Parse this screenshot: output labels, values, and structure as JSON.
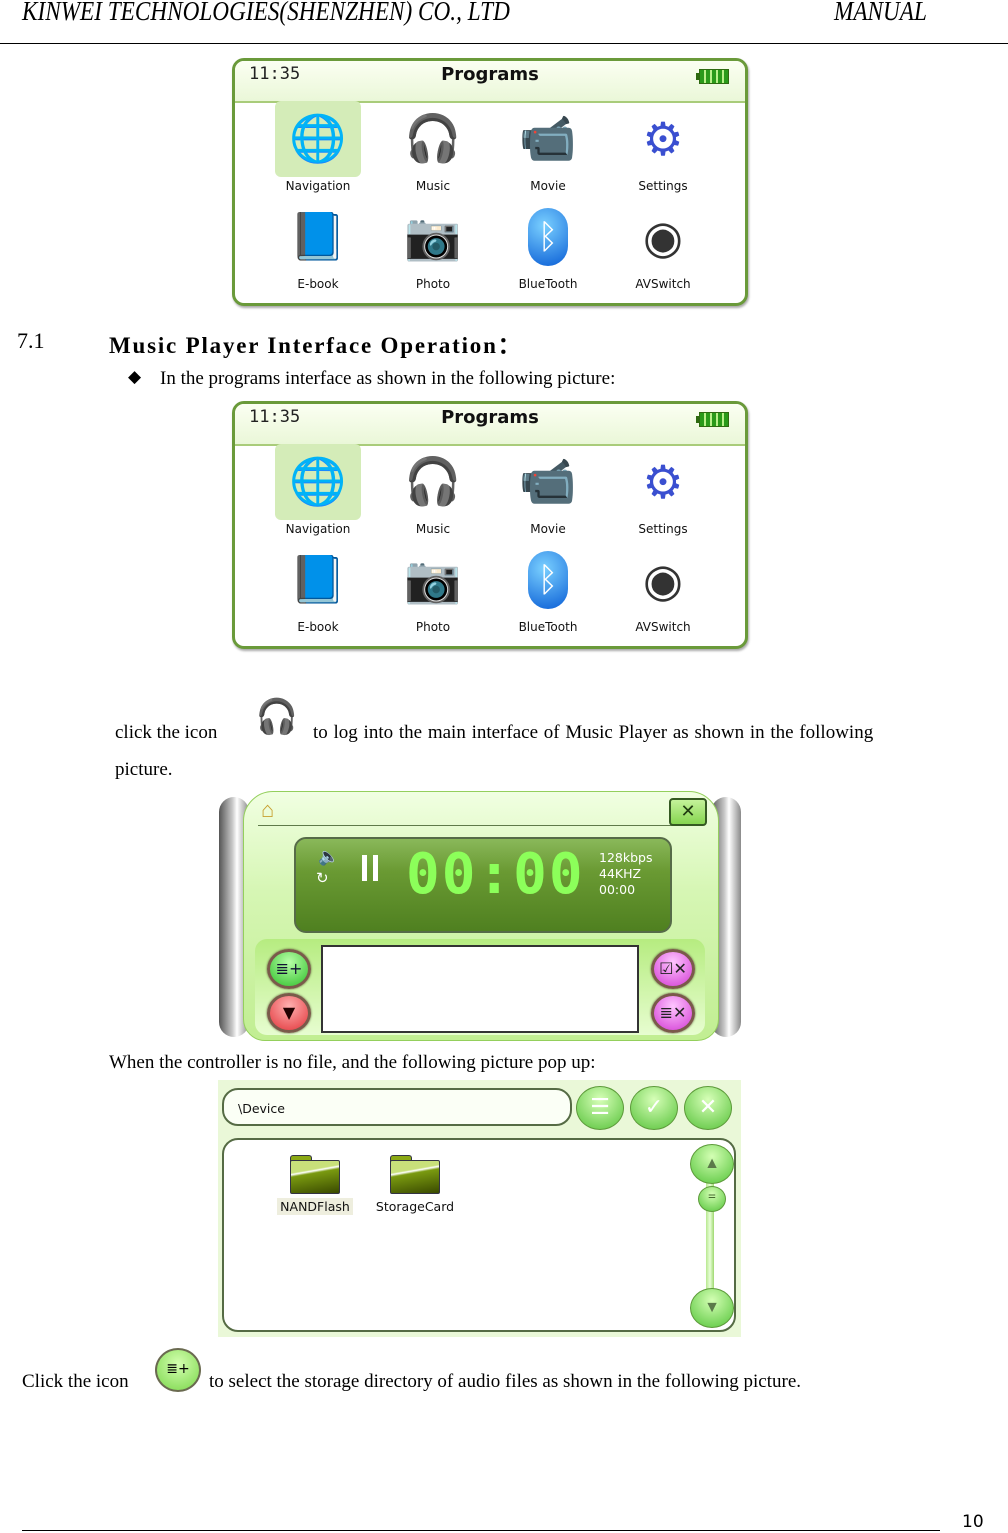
{
  "header": {
    "company": "KINWEI TECHNOLOGIES(SHENZHEN) CO., LTD",
    "doc_type": "MANUAL"
  },
  "programs_screen": {
    "time": "11:35",
    "title": "Programs",
    "battery_icon": "battery-full-icon",
    "items": [
      {
        "label": "Navigation",
        "icon": "globe-icon",
        "glyph": "🌐",
        "selected": true
      },
      {
        "label": "Music",
        "icon": "headphones-music-icon",
        "glyph": "🎧",
        "selected": false
      },
      {
        "label": "Movie",
        "icon": "video-camera-icon",
        "glyph": "📹",
        "selected": false
      },
      {
        "label": "Settings",
        "icon": "gear-wrench-icon",
        "glyph": "⚙",
        "selected": false
      },
      {
        "label": "E-book",
        "icon": "book-magnifier-icon",
        "glyph": "📘",
        "selected": false
      },
      {
        "label": "Photo",
        "icon": "camera-icon",
        "glyph": "📷",
        "selected": false
      },
      {
        "label": "BlueTooth",
        "icon": "bluetooth-icon",
        "glyph": "ᛒ",
        "selected": false
      },
      {
        "label": "AVSwitch",
        "icon": "dome-camera-icon",
        "glyph": "◉",
        "selected": false
      }
    ]
  },
  "section": {
    "number": "7.1",
    "title": "Music Player Interface Operation："
  },
  "bullet": {
    "glyph": "◆",
    "text": "In the programs interface as shown in the following picture:"
  },
  "paragraph1": {
    "before_icon": "click the icon",
    "after_icon": "to log into the main interface of Music Player as shown in the following",
    "continuation": "picture."
  },
  "music_player": {
    "home_glyph": "⌂",
    "close_glyph": "✕",
    "speaker_glyph": "🔈",
    "repeat_glyph": "↻",
    "time_display": "00:00",
    "bitrate": "128kbps",
    "sample_rate": "44KHZ",
    "total_time": "00:00",
    "buttons": {
      "add_list": "≣+",
      "move_down": "▼",
      "delete_checked": "☑✕",
      "delete_all": "≣✕"
    }
  },
  "paragraph2": "When the controller is no file, and the following picture pop up:",
  "file_browser": {
    "path": "\\Device",
    "buttons": {
      "list": "☰",
      "ok": "✓",
      "cancel": "✕"
    },
    "scroll_up": "▲",
    "scroll_down": "▼",
    "thumb": "=",
    "folders": [
      {
        "label": "NANDFlash",
        "selected": true
      },
      {
        "label": "StorageCard",
        "selected": false
      }
    ]
  },
  "paragraph3": {
    "before_icon": "Click the icon",
    "icon_glyph": "≣+",
    "after_icon": "to select the storage directory of audio files as shown in the following picture."
  },
  "footer": {
    "page_number": "10"
  }
}
